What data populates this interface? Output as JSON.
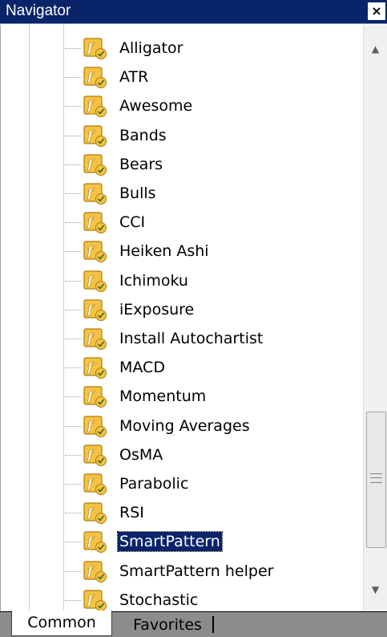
{
  "window": {
    "title": "Navigator",
    "close_symbol": "×"
  },
  "tree": {
    "icon": "custom-indicator-icon",
    "selected_index": 17,
    "items": [
      {
        "label": "Alligator"
      },
      {
        "label": "ATR"
      },
      {
        "label": "Awesome"
      },
      {
        "label": "Bands"
      },
      {
        "label": "Bears"
      },
      {
        "label": "Bulls"
      },
      {
        "label": "CCI"
      },
      {
        "label": "Heiken Ashi"
      },
      {
        "label": "Ichimoku"
      },
      {
        "label": "iExposure"
      },
      {
        "label": "Install Autochartist"
      },
      {
        "label": "MACD"
      },
      {
        "label": "Momentum"
      },
      {
        "label": "Moving Averages"
      },
      {
        "label": "OsMA"
      },
      {
        "label": "Parabolic"
      },
      {
        "label": "RSI"
      },
      {
        "label": "SmartPattern"
      },
      {
        "label": "SmartPattern helper"
      },
      {
        "label": "Stochastic"
      }
    ]
  },
  "scrollbar": {
    "up_symbol": "▲",
    "down_symbol": "▼"
  },
  "tabs": [
    {
      "label": "Common",
      "active": true
    },
    {
      "label": "Favorites",
      "active": false
    }
  ],
  "colors": {
    "titlebar": "#0a246a",
    "selection": "#0a246a",
    "icon_fill": "#f5c242",
    "icon_border": "#b07d10",
    "icon_glyph": "#3a6b1f"
  }
}
